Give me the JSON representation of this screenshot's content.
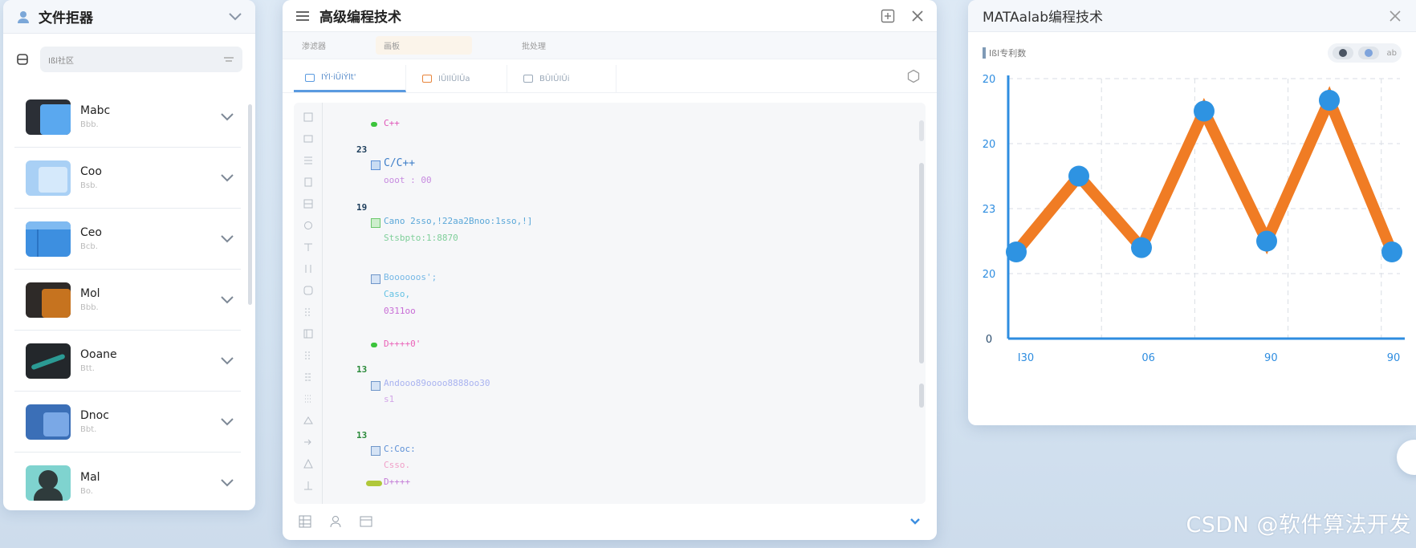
{
  "left_panel": {
    "title": "文件拒器",
    "search": {
      "placeholder": "Ißl社区"
    },
    "items": [
      {
        "name": "Mabc",
        "sub": "Bbb."
      },
      {
        "name": "Coo",
        "sub": "Bsb."
      },
      {
        "name": "Ceo",
        "sub": "Bcb."
      },
      {
        "name": "Mol",
        "sub": "Bbb."
      },
      {
        "name": "Ooane",
        "sub": "Btt."
      },
      {
        "name": "Dnoc",
        "sub": "Bbt."
      },
      {
        "name": "Mal",
        "sub": "Bo."
      }
    ]
  },
  "middle_panel": {
    "title": "高级编程技术",
    "menus": [
      "渗滤器",
      "画板",
      "批处理"
    ],
    "tabs": [
      "IÝl·i­ÛiÝlt­'",
      "IÛIlÛlÛa",
      "BÛIÛIÛi"
    ],
    "code": [
      {
        "text": "C++",
        "color": "#e055b8"
      },
      {
        "text": "C/C++",
        "color": "#3e7ec8"
      },
      {
        "text": "ooot : 00",
        "color": "#c78be0"
      },
      {
        "text": "Cano 2sso,!22aa2Bnoo:1sso,!]",
        "color": "#5aa7d8"
      },
      {
        "text": "Stsbpto:1:8870",
        "color": "#7fcf9a"
      },
      {
        "text": "Boooooos';",
        "color": "#76b8e6"
      },
      {
        "text": "Caso,",
        "color": "#63c1e3"
      },
      {
        "text": "0311oo",
        "color": "#c86dd6"
      },
      {
        "text": "D++++0'",
        "color": "#ea62b8"
      },
      {
        "text": "Andooo89oooo8888oo30",
        "color": "#a9b3f0"
      },
      {
        "text": "s1",
        "color": "#d3a6e8"
      },
      {
        "text": "C:Coc:",
        "color": "#5b8fd6"
      },
      {
        "text": "Csso.",
        "color": "#f0a0c8"
      },
      {
        "text": "D++++",
        "color": "#c37ad6"
      }
    ],
    "markers": [
      "23",
      "19",
      "13",
      "13"
    ]
  },
  "right_panel": {
    "title": "MATAalab编程技术",
    "toolbar_label": "Ißl专利数",
    "toggle_text": "ab"
  },
  "chart_data": {
    "type": "line",
    "x": [
      1,
      2,
      3,
      4,
      5,
      6,
      7
    ],
    "values": [
      200,
      235,
      202,
      265,
      205,
      270,
      200
    ],
    "x_tick_labels": [
      "I30",
      "06",
      "90",
      "90"
    ],
    "y_tick_labels": [
      "0",
      "20",
      "23",
      "20",
      "20"
    ],
    "line_color": "#f07c24",
    "marker_color": "#2e93e2",
    "grid": true,
    "title": "",
    "xlabel": "",
    "ylabel": ""
  },
  "watermark": "CSDN @软件算法开发",
  "colors": {
    "accent": "#2e93e2",
    "line": "#f07c24"
  }
}
